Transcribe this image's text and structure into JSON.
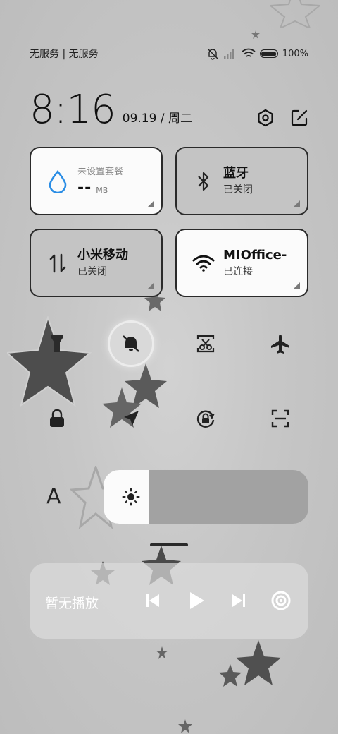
{
  "status_bar": {
    "carrier_label": "无服务 | 无服务",
    "battery_text": "100%",
    "icons": [
      "mute-icon",
      "signal-icon",
      "wifi-icon",
      "battery-icon"
    ]
  },
  "header": {
    "time": "8:16",
    "date": "09.19 / 周二",
    "icons": [
      "settings-icon",
      "edit-icon"
    ]
  },
  "tiles": {
    "data": {
      "plan_label": "未设置套餐",
      "value": "--",
      "unit": "MB",
      "icon": "water-drop-icon",
      "accent": "#2a8de5"
    },
    "bluetooth": {
      "title": "蓝牙",
      "status": "已关闭",
      "icon": "bluetooth-icon"
    },
    "mobile": {
      "title": "小米移动",
      "status": "已关闭",
      "icon": "mobile-data-icon"
    },
    "wifi": {
      "title": "MIOffice-",
      "status": "已连接",
      "icon": "wifi-icon"
    }
  },
  "quick_toggles": {
    "row1": [
      {
        "icon": "flashlight-icon",
        "active": false
      },
      {
        "icon": "mute-bell-icon",
        "active": true
      },
      {
        "icon": "screenshot-icon",
        "active": false
      },
      {
        "icon": "airplane-icon",
        "active": false
      }
    ],
    "row2": [
      {
        "icon": "lock-icon",
        "active": false
      },
      {
        "icon": "location-icon",
        "active": false
      },
      {
        "icon": "rotation-lock-icon",
        "active": false
      },
      {
        "icon": "scan-icon",
        "active": false
      }
    ]
  },
  "brightness": {
    "auto_label": "A",
    "level": 0.22,
    "icon": "sun-icon"
  },
  "media": {
    "label": "暂无播放",
    "controls": [
      "previous-icon",
      "play-icon",
      "next-icon",
      "cast-icon"
    ]
  }
}
